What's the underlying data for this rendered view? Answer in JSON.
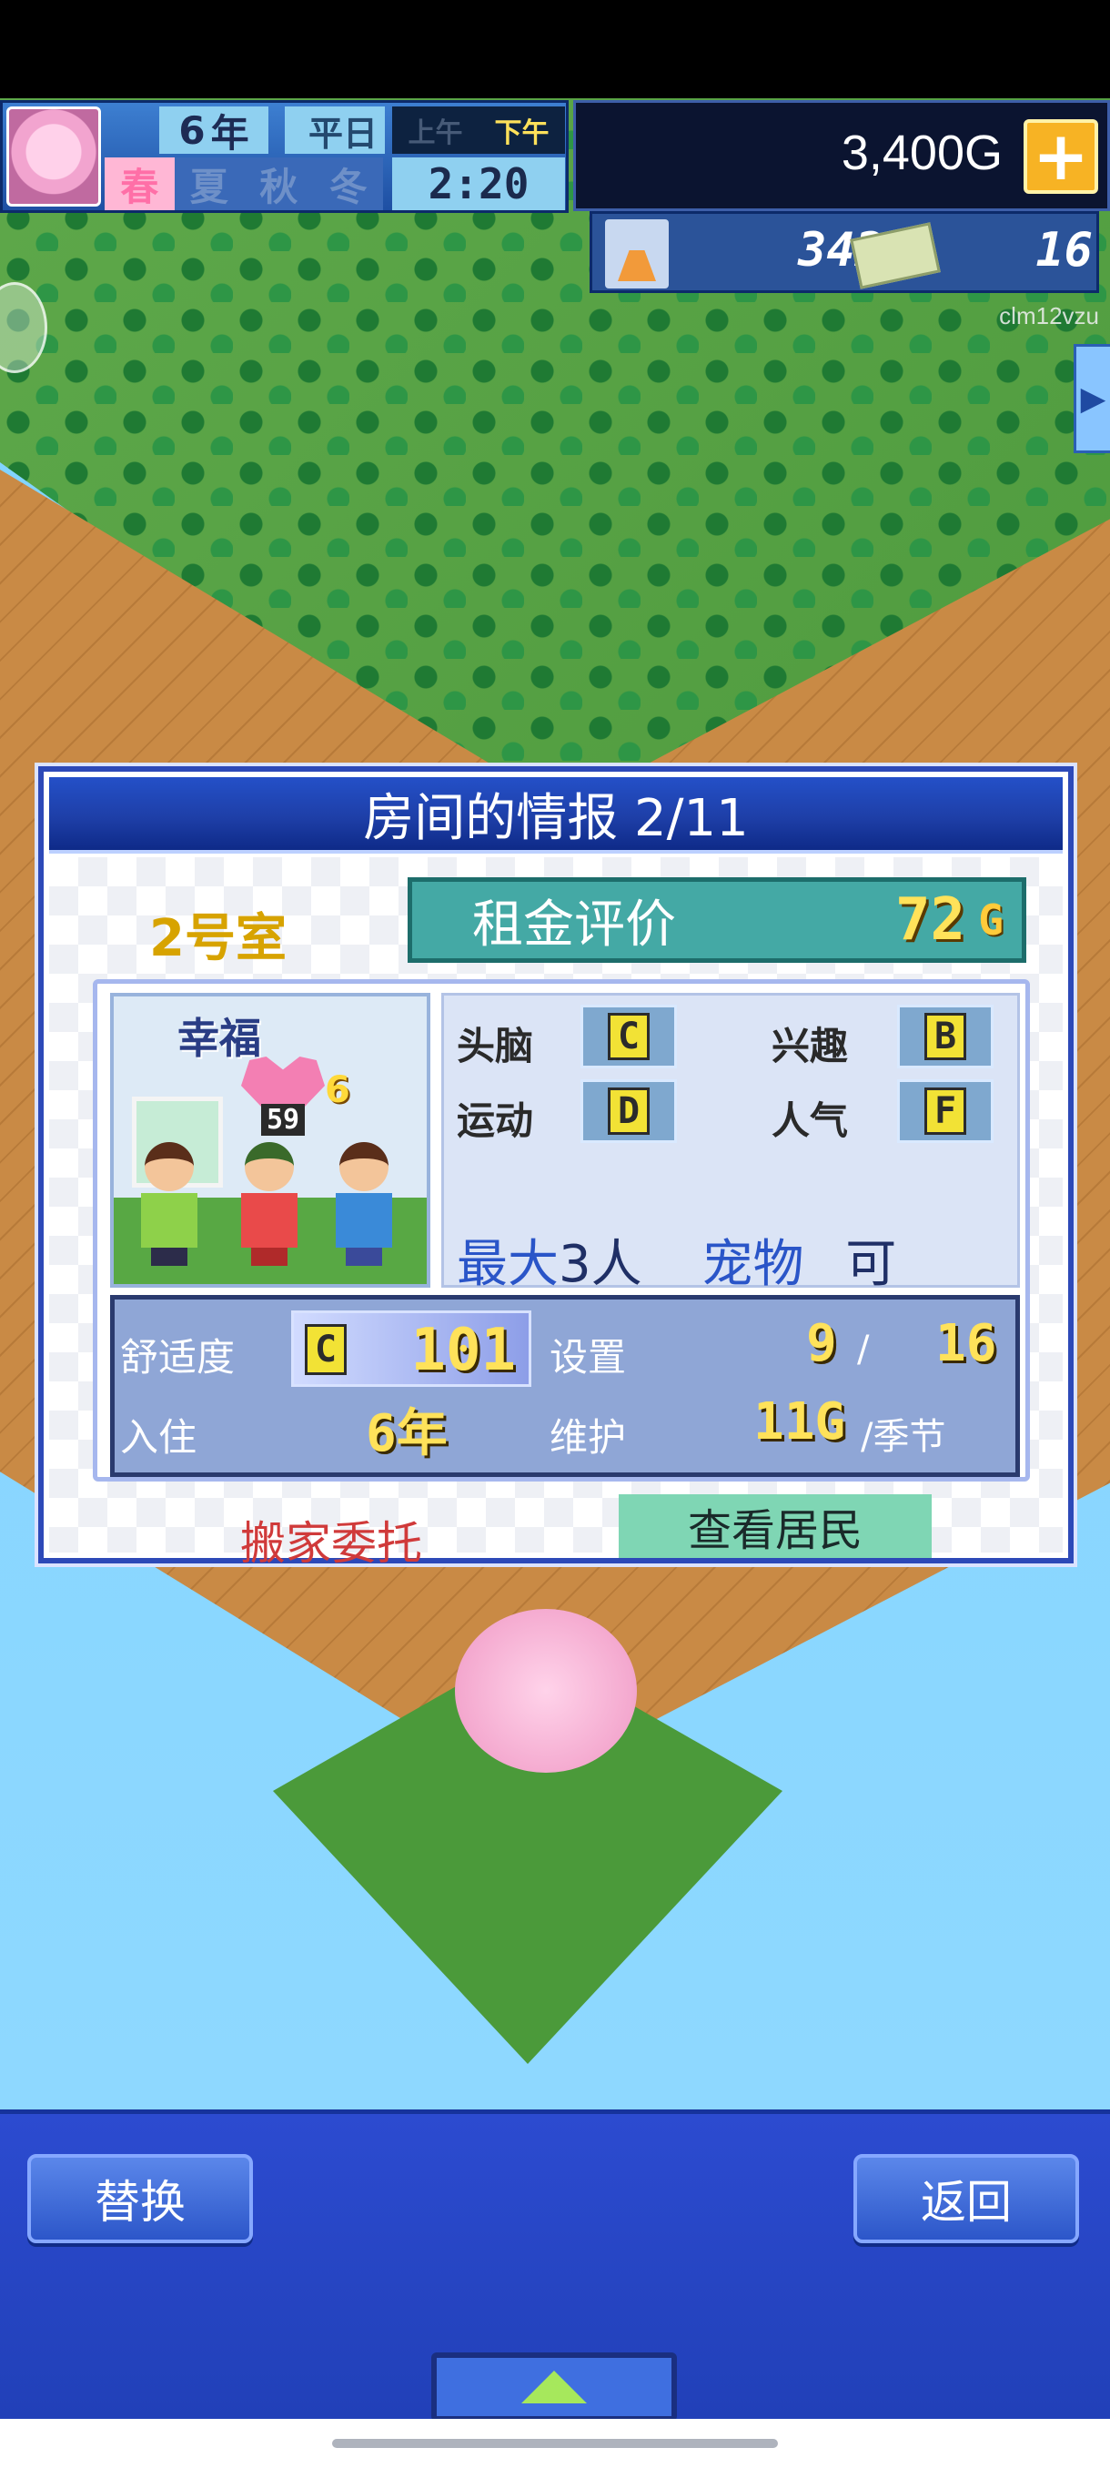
{
  "hud": {
    "year_num": "6",
    "year_unit": "年",
    "weekday": "平日",
    "am": "上午",
    "pm": "下午",
    "seasons": [
      "春",
      "夏",
      "秋",
      "冬"
    ],
    "active_season_index": 0,
    "time": "2:20",
    "money": "3,400G",
    "add_money_symbol": "+",
    "research_points": "342",
    "tickets": "16",
    "user_id": "clm12vzu"
  },
  "dialog": {
    "title": "房间的情报 2/11",
    "room_name": "2号室",
    "rent_label": "租金评价",
    "rent_value": "72",
    "rent_unit": "G",
    "happiness_label": "幸福",
    "happiness_score": "59",
    "happiness_level": "6",
    "stats": {
      "brain_label": "头脑",
      "brain_grade": "C",
      "hobby_label": "兴趣",
      "hobby_grade": "B",
      "sport_label": "运动",
      "sport_grade": "D",
      "popularity_label": "人气",
      "popularity_grade": "F"
    },
    "capacity_prefix": "最大",
    "capacity_value": "3人",
    "pets_label": "宠物",
    "pets_value": "可",
    "comfort_label": "舒适度",
    "comfort_grade": "C",
    "comfort_value": "101",
    "facilities_label": "设置",
    "facilities_used": "9",
    "facilities_sep": "/",
    "facilities_max": "16",
    "residence_label": "入住",
    "residence_years": "6年",
    "maintenance_label": "维护",
    "maintenance_value": "11G",
    "maintenance_unit": "/季节",
    "move_request": "搬家委托",
    "view_residents": "查看居民"
  },
  "bottom": {
    "replace": "替换",
    "back": "返回"
  },
  "colors": {
    "dialog_border": "#2d49b8",
    "rent_box": "#44a9a5",
    "grade_yellow": "#f2e235",
    "move_request_red": "#d03a3a",
    "view_residents_green": "#7fd6b4",
    "bottom_bar": "#2140b8"
  },
  "icons": {
    "season": "cherry-blossom-icon",
    "money_add": "plus-icon",
    "research": "flask-icon",
    "ticket": "ticket-icon",
    "side": "chevron-right-icon",
    "pause": "pause-icon",
    "expand": "triangle-up-icon"
  }
}
